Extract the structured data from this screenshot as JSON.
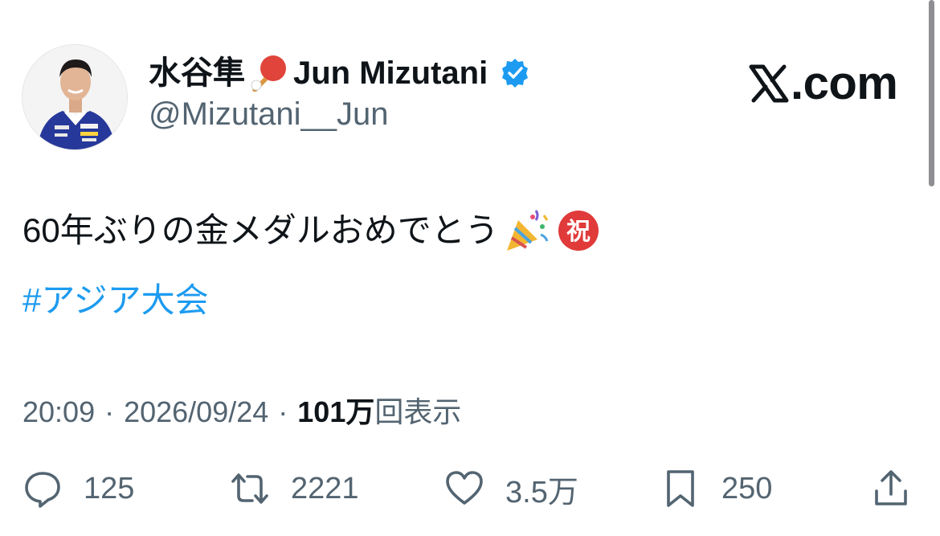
{
  "author": {
    "name_jp": "水谷隼",
    "name_en": "Jun Mizutani",
    "handle": "@Mizutani__Jun",
    "icons": [
      "ping-pong-icon",
      "verified-badge-icon"
    ]
  },
  "brand": {
    "domain_text": ".com",
    "logo": "x-logo-icon"
  },
  "tweet": {
    "text": "60年ぶりの金メダルおめでとう",
    "emojis": [
      "party-popper-icon",
      "congratulations-sign-icon"
    ],
    "hashtag": "#アジア大会"
  },
  "meta": {
    "time": "20:09",
    "date": "2026/09/24",
    "separator": "·",
    "views_count": "101万",
    "views_label": "回表示"
  },
  "actions": {
    "reply_count": "125",
    "retweet_count": "2221",
    "like_count": "3.5万",
    "bookmark_count": "250"
  },
  "colors": {
    "text": "#0f1419",
    "secondary": "#536471",
    "link": "#1d9bf0",
    "verified": "#1d9bf0"
  }
}
